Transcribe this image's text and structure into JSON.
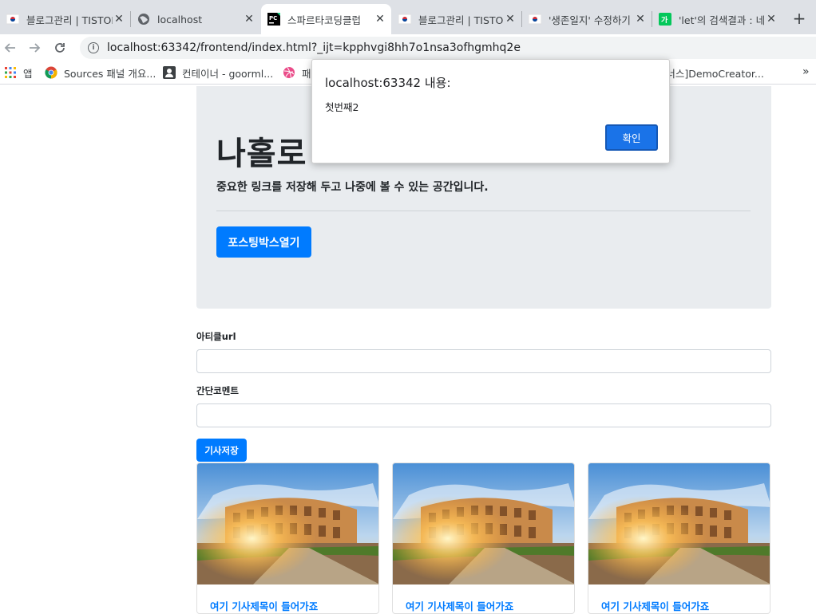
{
  "browser": {
    "tabs": [
      {
        "title": "블로그관리 | TISTORY",
        "active": false
      },
      {
        "title": "localhost",
        "active": false
      },
      {
        "title": "스파르타코딩클럽",
        "active": true
      },
      {
        "title": "블로그관리 | TISTORY",
        "active": false
      },
      {
        "title": "'생존일지' 수정하기",
        "active": false
      },
      {
        "title": "'let'의 검색결과 : 네이버",
        "active": false
      }
    ],
    "url": "localhost:63342/frontend/index.html?_ijt=kpphvgi8hh7o1nsa3ofhgmhq2e",
    "bookmarks": {
      "apps": "앱",
      "sources": "Sources 패널 개요...",
      "goorm": "컨테이너 - goorml...",
      "third": "패",
      "demo": "[보너스]DemoCreator..."
    }
  },
  "jumbotron": {
    "title": "나홀로",
    "lead": "중요한 링크를 저장해 두고 나중에 볼 수 있는 공간입니다.",
    "open_button": "포스팅박스열기"
  },
  "form": {
    "url_label": "아티클url",
    "comment_label": "간단코멘트",
    "save_button": "기사저장"
  },
  "cards": [
    {
      "title": "여기 기사제목이 들어가죠"
    },
    {
      "title": "여기 기사제목이 들어가죠"
    },
    {
      "title": "여기 기사제목이 들어가죠"
    }
  ],
  "alert": {
    "title": "localhost:63342 내용:",
    "message": "첫번째2",
    "ok_button": "확인"
  },
  "colors": {
    "primary": "#007bff",
    "jumbotron_bg": "#e9ecef",
    "dialog_button": "#1a73e8"
  }
}
